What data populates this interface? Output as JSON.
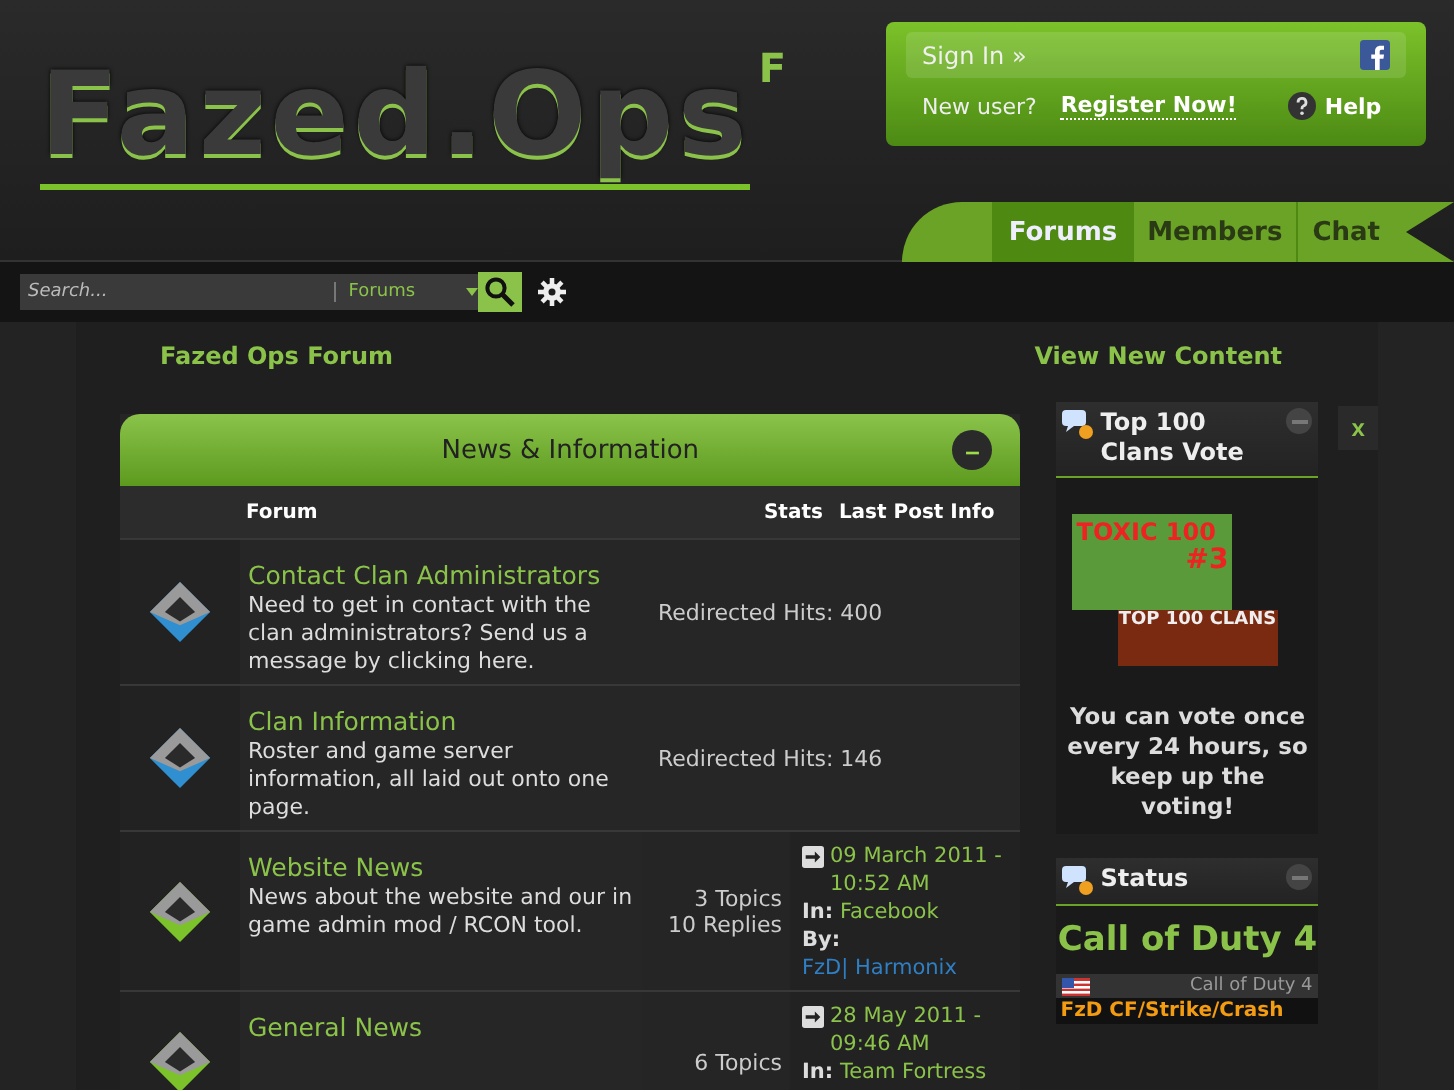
{
  "logo": {
    "text": "Fazed.Ops",
    "tag": "F"
  },
  "user_panel": {
    "sign_in": "Sign In »",
    "new_user": "New user?",
    "register": "Register Now!",
    "help": "Help"
  },
  "tabs": [
    {
      "label": "Forums",
      "selected": true
    },
    {
      "label": "Members",
      "selected": false
    },
    {
      "label": "Chat",
      "selected": false
    }
  ],
  "search": {
    "placeholder": "Search...",
    "scope": "Forums"
  },
  "breadcrumb": "Fazed Ops Forum",
  "view_new": "View New Content",
  "category": {
    "title": "News & Information",
    "collapse": "–",
    "columns": [
      "Forum",
      "Stats",
      "Last Post Info"
    ],
    "forums": [
      {
        "name": "Contact Clan Administrators",
        "description": "Need to get in contact with the clan administrators? Send us a message by clicking here.",
        "unread": false,
        "kind": "redirect",
        "hits": "Redirected Hits: 400"
      },
      {
        "name": "Clan Information",
        "description": "Roster and game server information, all laid out onto one page.",
        "unread": false,
        "kind": "redirect",
        "hits": "Redirected Hits: 146"
      },
      {
        "name": "Website News",
        "description": "News about the website and our in game admin mod / RCON tool.",
        "unread": true,
        "kind": "forum",
        "topics": "3 Topics",
        "replies": "10 Replies",
        "last_date": "09 March 2011 - 10:52 AM",
        "in_label": "In:",
        "in_topic": "Facebook",
        "by_label": "By:",
        "by_user": "FzD| Harmonix"
      },
      {
        "name": "General News",
        "unread": true,
        "kind": "forum",
        "topics": "6 Topics",
        "last_date": "28 May 2011 - 09:46 AM",
        "in_label": "In:",
        "in_topic": "Team Fortress"
      }
    ]
  },
  "sidebar": [
    {
      "kind": "vote",
      "title": "Top 100 Clans Vote",
      "banner_top": "TOXIC 100",
      "banner_rank": "#3",
      "banner_bottom": "TOP 100 CLANS",
      "text": "You can vote once every 24 hours, so keep up the voting!"
    },
    {
      "kind": "status",
      "title": "Status",
      "game": "Call of Duty 4",
      "server_game": "Call of Duty 4",
      "server_name": "FzD CF/Strike/Crash"
    }
  ],
  "close": "x"
}
